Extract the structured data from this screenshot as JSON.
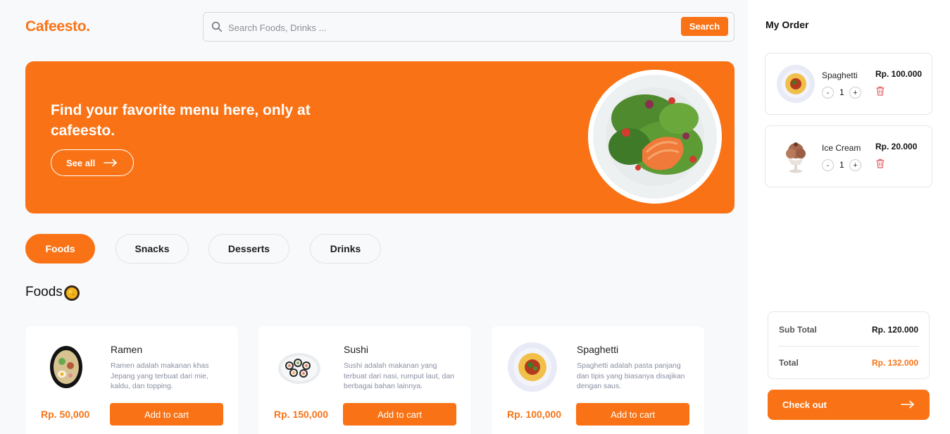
{
  "brand": {
    "name": "Cafeesto.",
    "accent": "#f97316"
  },
  "search": {
    "placeholder": "Search Foods, Drinks ...",
    "button_label": "Search"
  },
  "hero": {
    "headline": "Find your favorite menu here, only at cafeesto.",
    "cta_label": "See all",
    "image": "salmon-salad-plate"
  },
  "categories": [
    {
      "label": "Foods",
      "active": true
    },
    {
      "label": "Snacks",
      "active": false
    },
    {
      "label": "Desserts",
      "active": false
    },
    {
      "label": "Drinks",
      "active": false
    }
  ],
  "section": {
    "title": "Foods",
    "emoji_icon": "bowl-icon"
  },
  "products": [
    {
      "name": "Ramen",
      "description": "Ramen adalah makanan khas Jepang yang terbuat dari mie, kaldu, dan topping.",
      "price": "Rp. 50,000",
      "button_label": "Add to cart",
      "image": "ramen-bowl"
    },
    {
      "name": "Sushi",
      "description": "Sushi adalah makanan yang terbuat dari nasi, rumput laut, dan berbagai bahan lainnya.",
      "price": "Rp. 150,000",
      "button_label": "Add to cart",
      "image": "sushi-plate"
    },
    {
      "name": "Spaghetti",
      "description": "Spaghetti adalah pasta panjang dan tipis yang biasanya disajikan dengan saus.",
      "price": "Rp. 100,000",
      "button_label": "Add to cart",
      "image": "spaghetti-plate"
    }
  ],
  "order": {
    "title": "My Order",
    "items": [
      {
        "name": "Spaghetti",
        "price": "Rp. 100.000",
        "qty": "1",
        "minus": "-",
        "plus": "+",
        "image": "spaghetti-plate"
      },
      {
        "name": "Ice Cream",
        "price": "Rp. 20.000",
        "qty": "1",
        "minus": "-",
        "plus": "+",
        "image": "ice-cream-cup"
      }
    ],
    "subtotal_label": "Sub Total",
    "subtotal_value": "Rp. 120.000",
    "total_label": "Total",
    "total_value": "Rp. 132.000",
    "checkout_label": "Check out"
  }
}
